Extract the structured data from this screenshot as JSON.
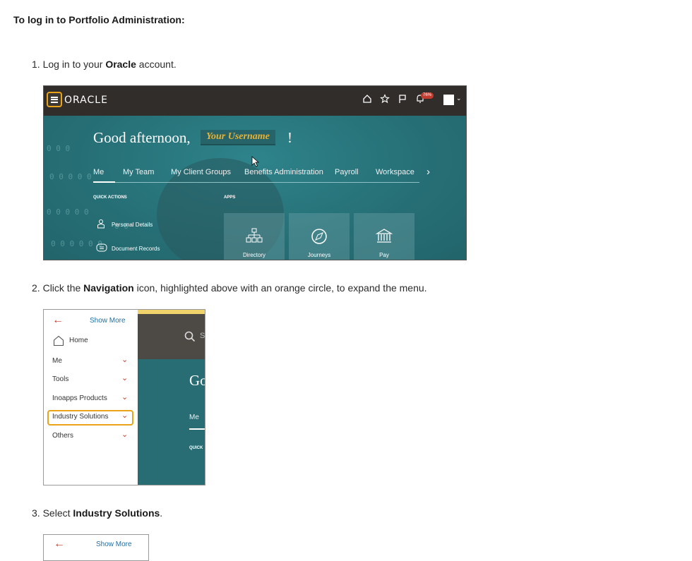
{
  "heading": "To log in to Portfolio Administration:",
  "steps": [
    {
      "num": "1.",
      "pre": "Log in to your ",
      "bold": "Oracle",
      "post": " account."
    },
    {
      "num": "2.",
      "pre": "Click the ",
      "bold": "Navigation",
      "post": " icon, highlighted above with an orange circle, to expand the menu."
    },
    {
      "num": "3.",
      "pre": "Select ",
      "bold": "Industry Solutions",
      "post": "."
    }
  ],
  "screenshot1": {
    "logo": "ORACLE",
    "greeting": "Good afternoon,",
    "username": "Your Username",
    "exclaim": "!",
    "notification_count": "76%",
    "tabs": [
      "Me",
      "My Team",
      "My Client Groups",
      "Benefits Administration",
      "Payroll",
      "Workspace"
    ],
    "quick_actions_label": "QUICK ACTIONS",
    "apps_label": "APPS",
    "quick_actions": [
      "Personal Details",
      "Document Records"
    ],
    "apps": [
      "Directory",
      "Journeys",
      "Pay"
    ]
  },
  "screenshot2": {
    "show_more": "Show More",
    "home": "Home",
    "menu": [
      "Me",
      "Tools",
      "Inoapps Products",
      "Industry Solutions",
      "Others"
    ],
    "peek": {
      "greet": "Go",
      "tab": "Me",
      "quick": "QUICK",
      "search": "S"
    }
  },
  "screenshot3": {
    "show_more": "Show More"
  },
  "colors": {
    "highlight": "#e8a317",
    "teal": "#2c7b82",
    "topbar": "#312d2a"
  }
}
